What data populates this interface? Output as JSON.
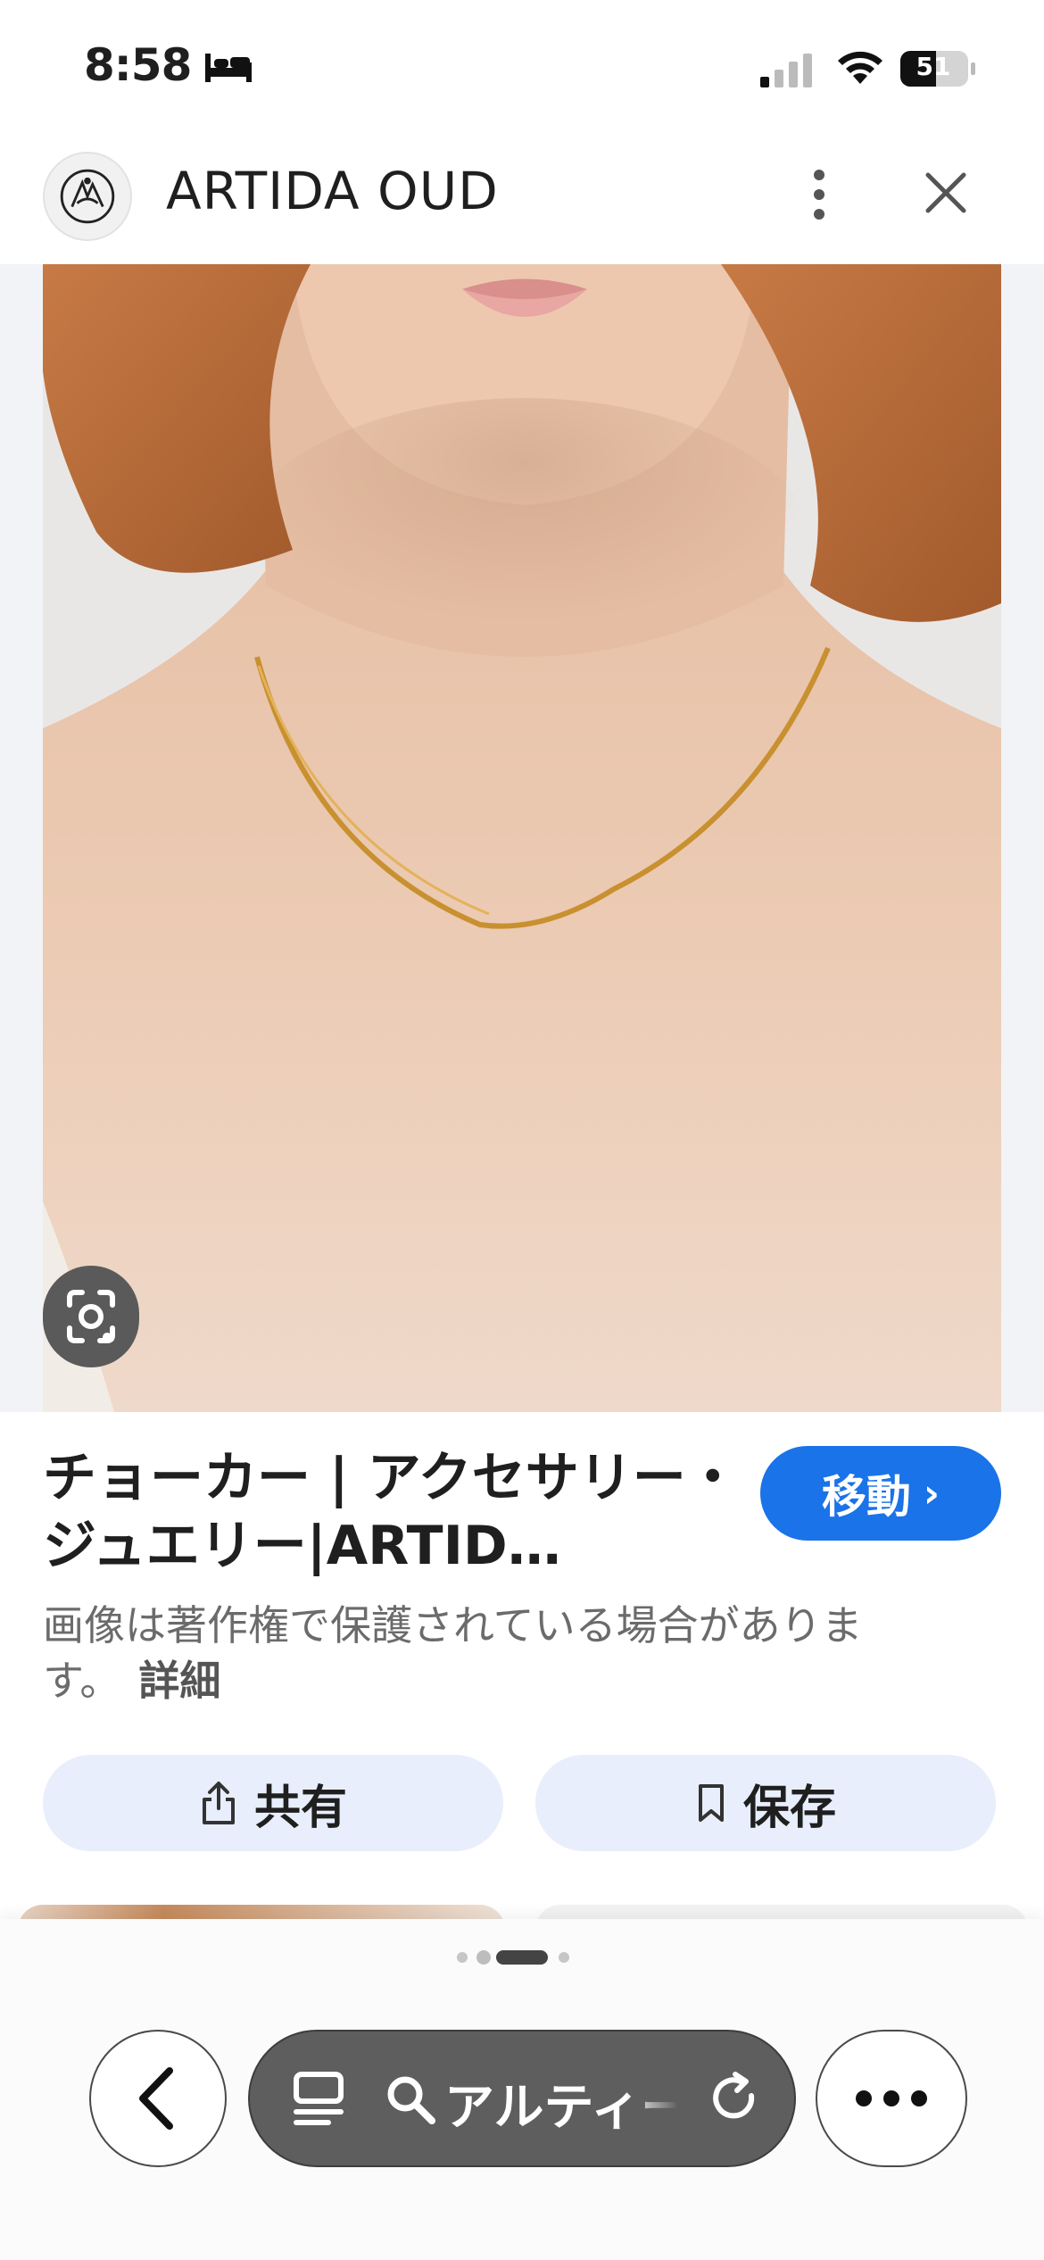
{
  "status_bar": {
    "time": "8:58",
    "battery_level": "51"
  },
  "header": {
    "site_title": "ARTIDA OUD"
  },
  "image": {
    "subject": "gold snake chain choker necklace on model"
  },
  "result": {
    "title": "チョーカー | アクセサリー・ジュエリー|ARTID…",
    "visit_label": "移動",
    "copyright_text": "画像は著作権で保護されている場合があります。",
    "details_label": "詳細"
  },
  "actions": {
    "share_label": "共有",
    "save_label": "保存"
  },
  "bottom_bar": {
    "search_text": "アルティー",
    "pager_active_index": 2,
    "pager_count": 4
  },
  "colors": {
    "accent": "#1a73e8",
    "action_bg": "#e8eefb",
    "pill_bg": "#5e5e5e"
  },
  "icons": [
    "bed-icon",
    "signal-icon",
    "wifi-icon",
    "battery-icon",
    "kebab-menu-icon",
    "close-icon",
    "lens-icon",
    "chevron-right-icon",
    "share-icon",
    "bookmark-icon",
    "back-arrow-icon",
    "tabs-icon",
    "search-icon",
    "reload-icon",
    "more-icon"
  ]
}
